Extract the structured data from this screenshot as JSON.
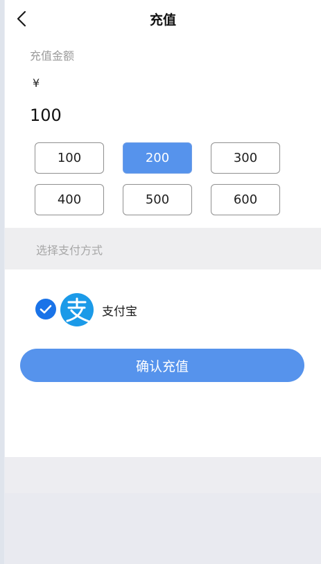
{
  "header": {
    "title": "充值",
    "back_icon": "chevron-left-icon"
  },
  "amount_section": {
    "label": "充值金额",
    "currency_symbol": "¥",
    "input_value": "100"
  },
  "options": [
    {
      "label": "100",
      "selected": false
    },
    {
      "label": "200",
      "selected": true
    },
    {
      "label": "300",
      "selected": false
    },
    {
      "label": "400",
      "selected": false
    },
    {
      "label": "500",
      "selected": false
    },
    {
      "label": "600",
      "selected": false
    }
  ],
  "payment": {
    "section_label": "选择支付方式",
    "method_name": "支付宝",
    "selected": true,
    "method_icon": "alipay-icon",
    "check_icon": "checkmark-icon"
  },
  "confirm_button": {
    "label": "确认充值"
  },
  "colors": {
    "accent": "#5693ec",
    "check_blue": "#1a73e8",
    "alipay_blue": "#1b9ae8"
  }
}
